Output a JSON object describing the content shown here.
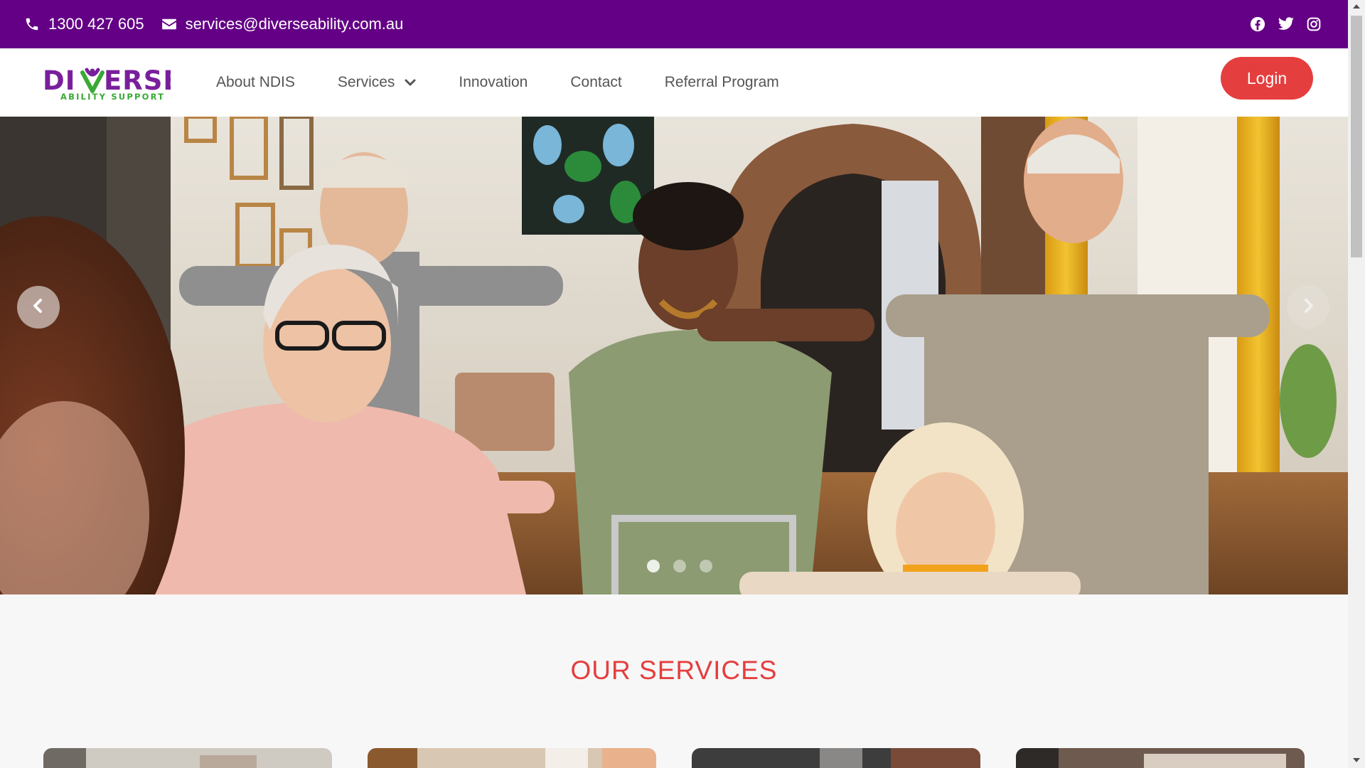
{
  "topbar": {
    "phone": "1300 427 605",
    "email": "services@diverseability.com.au",
    "phone_icon": "phone-icon",
    "email_icon": "envelope-icon",
    "social": [
      "facebook-icon",
      "twitter-icon",
      "instagram-icon"
    ]
  },
  "brand": {
    "logo_word": "DIVERSE",
    "logo_tagline": "ABILITY SUPPORT"
  },
  "nav": {
    "items": [
      {
        "label": "About NDIS"
      },
      {
        "label": "Services"
      },
      {
        "label": "Innovation"
      },
      {
        "label": "Contact"
      },
      {
        "label": "Referral Program"
      }
    ],
    "login_label": "Login"
  },
  "hero": {
    "slide_count": 3,
    "active_slide": 1
  },
  "services": {
    "title": "OUR SERVICES"
  },
  "colors": {
    "topbar_bg": "#630085",
    "accent_red": "#e53e3e",
    "logo_purple": "#7a1f9c",
    "logo_green": "#39a935",
    "nav_text": "#555555"
  }
}
